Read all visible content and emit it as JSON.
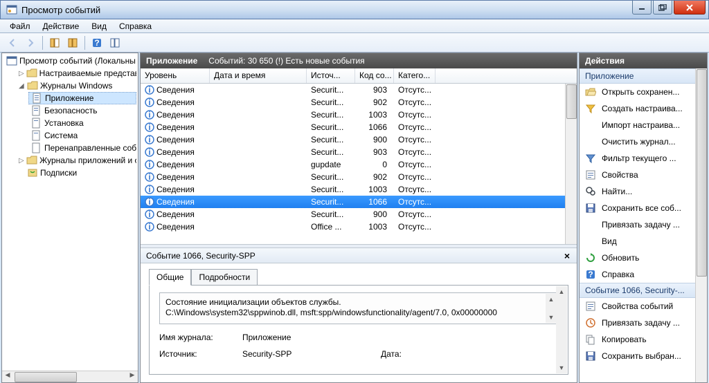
{
  "window": {
    "title": "Просмотр событий"
  },
  "menu": {
    "items": [
      "Файл",
      "Действие",
      "Вид",
      "Справка"
    ]
  },
  "tree": {
    "root": "Просмотр событий (Локальны",
    "customViews": "Настраиваемые представле",
    "winLogs": "Журналы Windows",
    "winChildren": [
      "Приложение",
      "Безопасность",
      "Установка",
      "Система",
      "Перенаправленные соб"
    ],
    "appLogs": "Журналы приложений и сл",
    "subscriptions": "Подписки"
  },
  "center": {
    "title": "Приложение",
    "subtitle": "Событий: 30 650 (!) Есть новые события",
    "columns": [
      "Уровень",
      "Дата и время",
      "Источ...",
      "Код со...",
      "Катего..."
    ],
    "rows": [
      {
        "level": "Сведения",
        "source": "Securit...",
        "code": "903",
        "cat": "Отсутс..."
      },
      {
        "level": "Сведения",
        "source": "Securit...",
        "code": "902",
        "cat": "Отсутс..."
      },
      {
        "level": "Сведения",
        "source": "Securit...",
        "code": "1003",
        "cat": "Отсутс..."
      },
      {
        "level": "Сведения",
        "source": "Securit...",
        "code": "1066",
        "cat": "Отсутс..."
      },
      {
        "level": "Сведения",
        "source": "Securit...",
        "code": "900",
        "cat": "Отсутс..."
      },
      {
        "level": "Сведения",
        "source": "Securit...",
        "code": "903",
        "cat": "Отсутс..."
      },
      {
        "level": "Сведения",
        "source": "gupdate",
        "code": "0",
        "cat": "Отсутс..."
      },
      {
        "level": "Сведения",
        "source": "Securit...",
        "code": "902",
        "cat": "Отсутс..."
      },
      {
        "level": "Сведения",
        "source": "Securit...",
        "code": "1003",
        "cat": "Отсутс..."
      },
      {
        "level": "Сведения",
        "source": "Securit...",
        "code": "1066",
        "cat": "Отсутс...",
        "selected": true
      },
      {
        "level": "Сведения",
        "source": "Securit...",
        "code": "900",
        "cat": "Отсутс..."
      },
      {
        "level": "Сведения",
        "source": "Office ...",
        "code": "1003",
        "cat": "Отсутс..."
      }
    ]
  },
  "detail": {
    "title": "Событие 1066, Security-SPP",
    "tabs": [
      "Общие",
      "Подробности"
    ],
    "text1": "Состояние инициализации объектов службы.",
    "text2": "C:\\Windows\\system32\\sppwinob.dll, msft:spp/windowsfunctionality/agent/7.0, 0x00000000",
    "fields": {
      "logLabel": "Имя журнала:",
      "logValue": "Приложение",
      "sourceLabel": "Источник:",
      "sourceValue": "Security-SPP",
      "dateLabel": "Дата:"
    }
  },
  "actions": {
    "title": "Действия",
    "section1": "Приложение",
    "items1": [
      {
        "icon": "open",
        "label": "Открыть сохранен..."
      },
      {
        "icon": "filter",
        "label": "Создать настраива..."
      },
      {
        "icon": "none",
        "label": "Импорт настраива..."
      },
      {
        "icon": "none",
        "label": "Очистить журнал..."
      },
      {
        "icon": "filter2",
        "label": "Фильтр текущего ..."
      },
      {
        "icon": "props",
        "label": "Свойства"
      },
      {
        "icon": "find",
        "label": "Найти..."
      },
      {
        "icon": "save",
        "label": "Сохранить все соб..."
      },
      {
        "icon": "none",
        "label": "Привязать задачу ..."
      },
      {
        "icon": "none",
        "label": "Вид",
        "arrow": true
      },
      {
        "icon": "refresh",
        "label": "Обновить"
      },
      {
        "icon": "help",
        "label": "Справка",
        "arrow": true
      }
    ],
    "section2": "Событие 1066, Security-...",
    "items2": [
      {
        "icon": "props",
        "label": "Свойства событий"
      },
      {
        "icon": "task",
        "label": "Привязать задачу ..."
      },
      {
        "icon": "copy",
        "label": "Копировать",
        "arrow": true
      },
      {
        "icon": "save",
        "label": "Сохранить выбран..."
      }
    ]
  }
}
